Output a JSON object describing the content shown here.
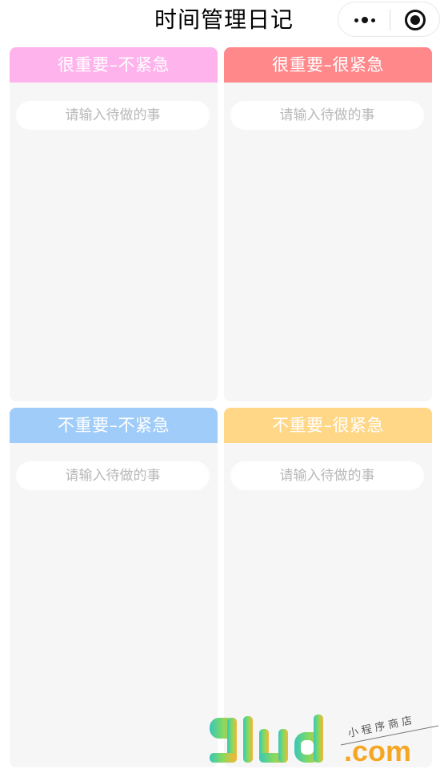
{
  "header": {
    "title": "时间管理日记",
    "more_icon": "more-dots-icon",
    "close_icon": "target-close-icon"
  },
  "quadrants": [
    {
      "title": "很重要–不紧急",
      "color": "#ffb3ec",
      "input_value": "",
      "input_placeholder": "请输入待做的事"
    },
    {
      "title": "很重要–很紧急",
      "color": "#ff888b",
      "input_value": "",
      "input_placeholder": "请输入待做的事"
    },
    {
      "title": "不重要–不紧急",
      "color": "#9fccf8",
      "input_value": "",
      "input_placeholder": "请输入待做的事"
    },
    {
      "title": "不重要–很紧急",
      "color": "#ffd787",
      "input_value": "",
      "input_placeholder": "请输入待做的事"
    }
  ],
  "watermark": {
    "logo_text": "91ud.com",
    "tagline": "小程序商店"
  }
}
